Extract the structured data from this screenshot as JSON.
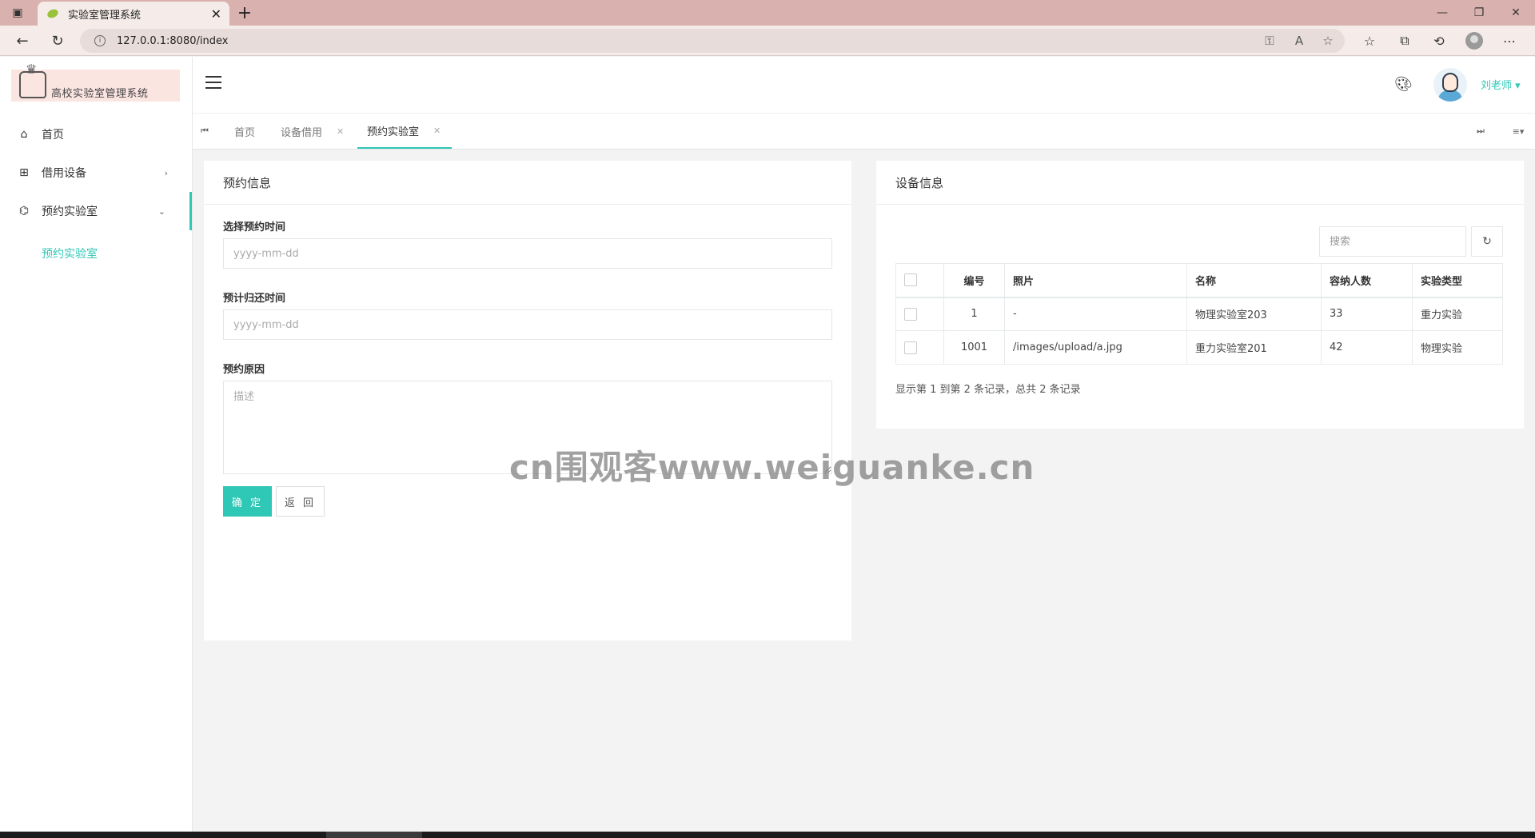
{
  "browser": {
    "tab_title": "实验室管理系统",
    "url": "127.0.0.1:8080/index"
  },
  "sidebar": {
    "logo_text": "高校实验室管理系统",
    "items": [
      {
        "label": "首页",
        "icon": "home-icon"
      },
      {
        "label": "借用设备",
        "icon": "device-icon"
      },
      {
        "label": "预约实验室",
        "icon": "lab-icon",
        "expanded": true
      }
    ],
    "sub_item": "预约实验室"
  },
  "header": {
    "user_name": "刘老师"
  },
  "page_tabs": [
    {
      "label": "首页",
      "closable": false
    },
    {
      "label": "设备借用",
      "closable": true
    },
    {
      "label": "预约实验室",
      "closable": true,
      "active": true
    }
  ],
  "form": {
    "title": "预约信息",
    "start_label": "选择预约时间",
    "start_placeholder": "yyyy-mm-dd",
    "end_label": "预计归还时间",
    "end_placeholder": "yyyy-mm-dd",
    "reason_label": "预约原因",
    "reason_placeholder": "描述",
    "ok_label": "确 定",
    "back_label": "返 回"
  },
  "equipment": {
    "title": "设备信息",
    "search_placeholder": "搜索",
    "columns": [
      "编号",
      "照片",
      "名称",
      "容纳人数",
      "实验类型"
    ],
    "rows": [
      {
        "id": "1",
        "photo": "-",
        "name": "物理实验室203",
        "capacity": "33",
        "type": "重力实验"
      },
      {
        "id": "1001",
        "photo": "/images/upload/a.jpg",
        "name": "重力实验室201",
        "capacity": "42",
        "type": "物理实验"
      }
    ],
    "pagination": "显示第 1 到第 2 条记录，总共 2 条记录"
  },
  "watermark": "cn围观客www.weiguanke.cn",
  "colors": {
    "accent": "#2fc7b6",
    "chrome": "#d9b1ae"
  }
}
